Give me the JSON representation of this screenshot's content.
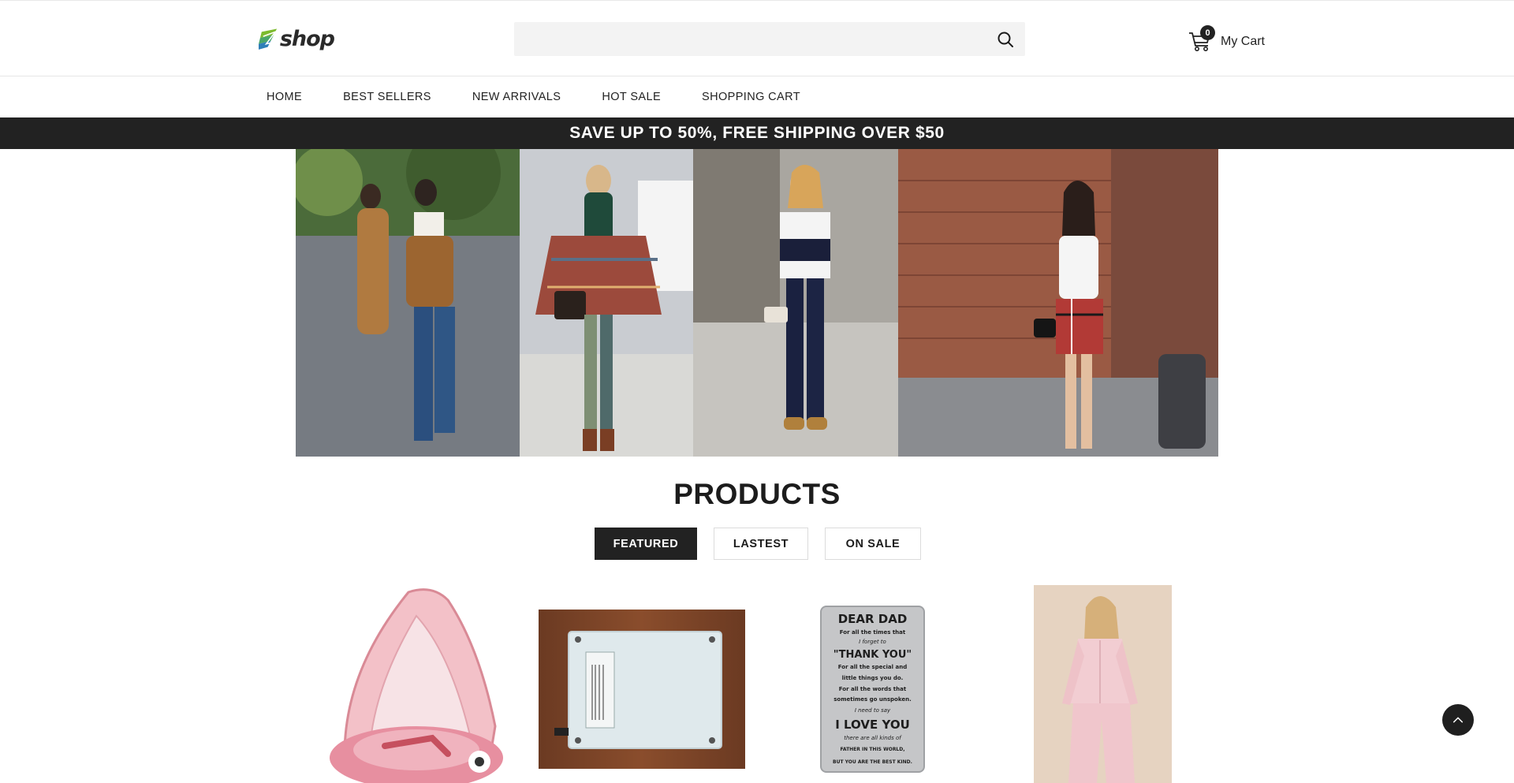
{
  "header": {
    "logo_text": "shop",
    "search": {
      "placeholder": "",
      "value": ""
    },
    "cart": {
      "count": "0",
      "label": "My Cart"
    }
  },
  "nav": {
    "items": [
      {
        "label": "HOME"
      },
      {
        "label": "BEST SELLERS"
      },
      {
        "label": "NEW ARRIVALS"
      },
      {
        "label": "HOT SALE"
      },
      {
        "label": "SHOPPING CART"
      }
    ]
  },
  "promo": {
    "text": "SAVE UP TO 50%, FREE SHIPPING OVER $50"
  },
  "products": {
    "title": "PRODUCTS",
    "tabs": [
      {
        "label": "FEATURED",
        "active": true
      },
      {
        "label": "LASTEST",
        "active": false
      },
      {
        "label": "ON SALE",
        "active": false
      }
    ],
    "items": [
      {
        "image": "pink-baby-float-with-canopy"
      },
      {
        "image": "siemens-electronic-device-on-wood"
      },
      {
        "image": "dear-dad-wallet-card",
        "card_lines": [
          "DEAR DAD",
          "For all the times that",
          "I forget to",
          "\"THANK YOU\"",
          "For all the special and",
          "little things you do.",
          "For all the words that",
          "sometimes go unspoken.",
          "I need to say",
          "I LOVE YOU",
          "there are all kinds of",
          "FATHER IN THIS WORLD,",
          "BUT YOU ARE THE BEST KIND."
        ]
      },
      {
        "image": "woman-pink-satin-pajamas"
      }
    ]
  },
  "colors": {
    "accent_dark": "#222222",
    "promo_bg": "#222222",
    "search_bg": "#f3f3f3",
    "logo_green": "#7dbb2e",
    "logo_blue": "#2f7fb8"
  },
  "icons": [
    "search-icon",
    "cart-icon",
    "chevron-up-icon"
  ]
}
